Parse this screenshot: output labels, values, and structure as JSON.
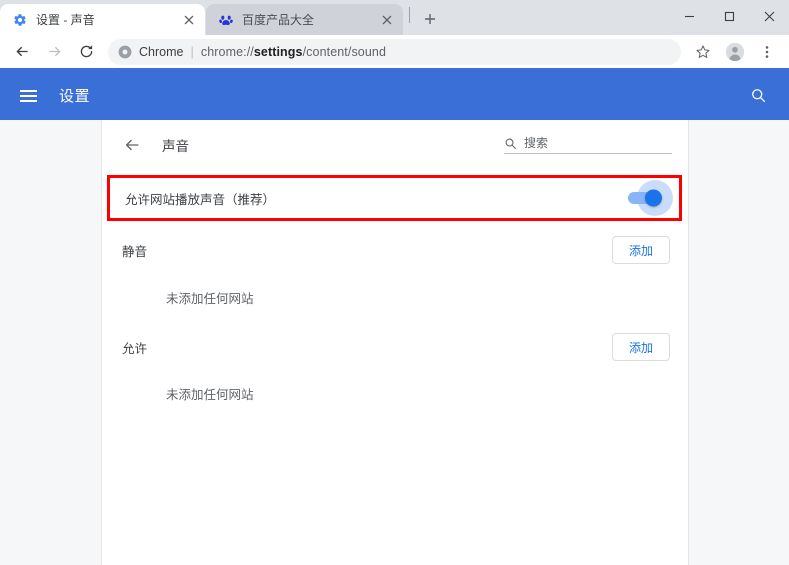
{
  "browser": {
    "tabs": [
      {
        "title": "设置 - 声音",
        "favicon": "settings-gear-icon",
        "active": true,
        "close_label": "×"
      },
      {
        "title": "百度产品大全",
        "favicon": "baidu-paw-icon",
        "active": false,
        "close_label": "×"
      }
    ],
    "new_tab_label": "+",
    "window_controls": {
      "minimize": "–",
      "maximize": "□",
      "close": "×"
    },
    "toolbar": {
      "back_label": "←",
      "forward_label": "→",
      "reload_label": "⟳",
      "omnibox": {
        "brand": "Chrome",
        "separator": "|",
        "scheme": "chrome://",
        "host": "settings",
        "path": "/content/sound",
        "full_url": "chrome://settings/content/sound"
      },
      "bookmark_label": "☆",
      "profile_label": "profile-avatar",
      "menu_label": "⋮"
    }
  },
  "settings": {
    "header": {
      "menu_label": "menu",
      "title": "设置",
      "search_label": "搜索设置"
    },
    "card": {
      "back_label": "返回",
      "title": "声音",
      "search_placeholder": "搜索",
      "search_value": ""
    },
    "toggle": {
      "label": "允许网站播放声音（推荐）",
      "state": "on",
      "highlight_color": "#ff0000"
    },
    "sections": [
      {
        "id": "mute",
        "title": "静音",
        "add_label": "添加",
        "empty_text": "未添加任何网站"
      },
      {
        "id": "allow",
        "title": "允许",
        "add_label": "添加",
        "empty_text": "未添加任何网站"
      }
    ]
  },
  "colors": {
    "settings_header_blue": "#3a6fd8",
    "toggle_blue": "#1a73e8",
    "toggle_track": "#8ab4f8",
    "link_blue": "#1a73e8",
    "highlight_red": "#ff0000",
    "page_bg": "#f6f7f9",
    "tabstrip_bg": "#dee1e6"
  }
}
